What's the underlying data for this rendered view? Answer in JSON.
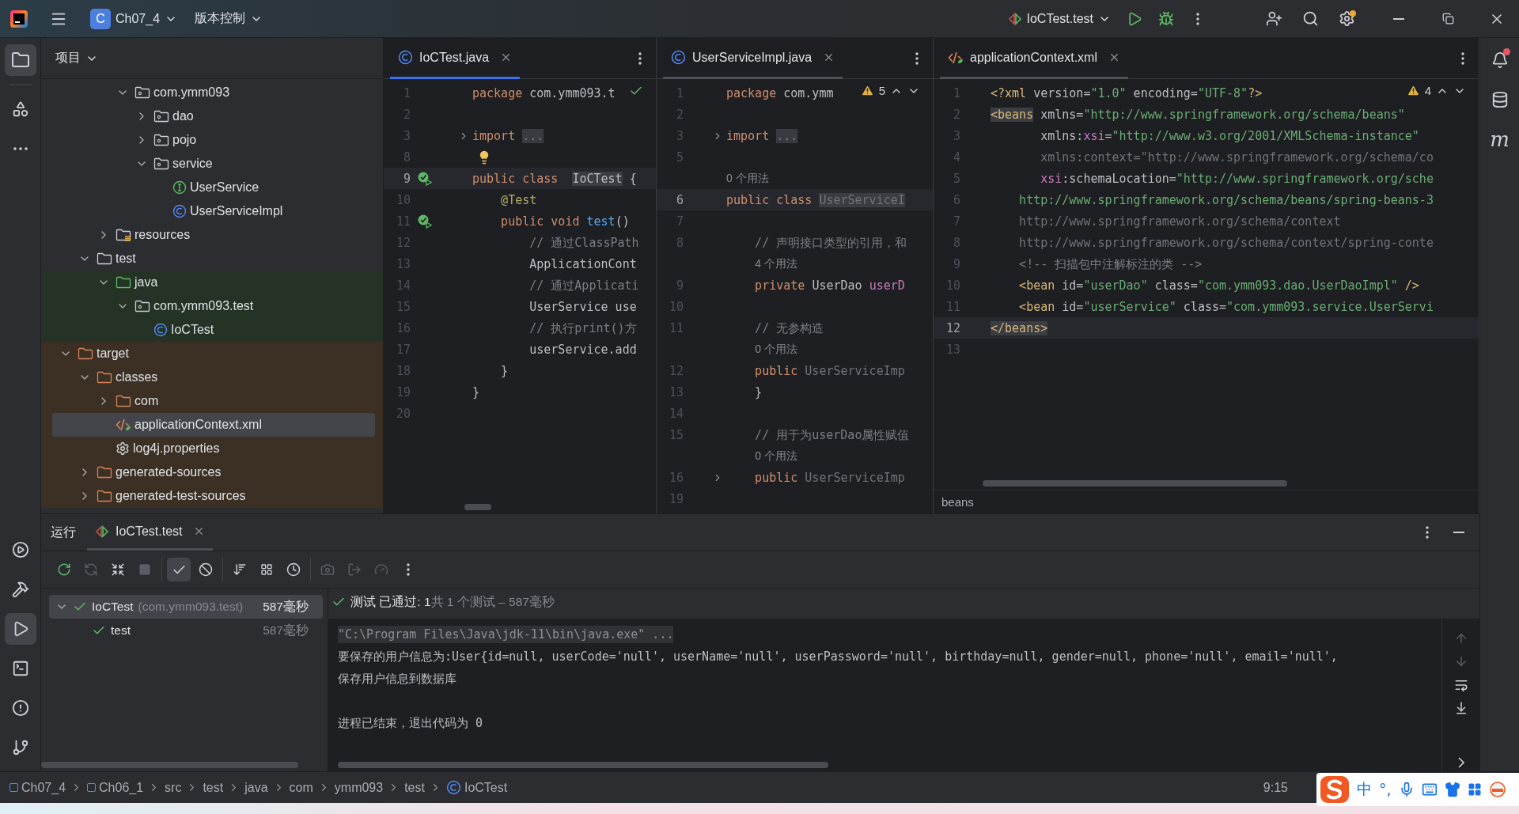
{
  "title_bar": {
    "project_badge": "C",
    "project": "Ch07_4",
    "vcs": "版本控制",
    "run_config": "IoCTest.test",
    "settings_badge": true
  },
  "left_toolbar": {
    "top": [
      {
        "kind": "project",
        "selected": true
      },
      {
        "kind": "structure",
        "selected": false
      },
      {
        "kind": "more",
        "selected": false
      }
    ],
    "bottom": [
      {
        "kind": "services",
        "selected": false
      },
      {
        "kind": "build",
        "selected": false
      },
      {
        "kind": "run",
        "selected": true
      },
      {
        "kind": "terminal",
        "selected": false
      },
      {
        "kind": "problems",
        "selected": false
      },
      {
        "kind": "git",
        "selected": false
      }
    ]
  },
  "right_toolbar": {
    "notifications_unread": true,
    "maven_label": "m"
  },
  "project": {
    "title": "项目",
    "tree": [
      {
        "children": [
          {
            "children": [
              {
                "children": [
                  {
                    "label": "com.ymm093",
                    "kind": "package",
                    "expanded": true,
                    "selected": false,
                    "children": [
                      {
                        "label": "dao",
                        "kind": "package",
                        "expanded": false,
                        "selected": false
                      },
                      {
                        "label": "pojo",
                        "kind": "package",
                        "expanded": false,
                        "selected": false
                      },
                      {
                        "label": "service",
                        "kind": "package",
                        "expanded": true,
                        "selected": false,
                        "children": [
                          {
                            "label": "UserService",
                            "kind": "interface",
                            "selected": false
                          },
                          {
                            "label": "UserServiceImpl",
                            "kind": "class",
                            "selected": false
                          }
                        ]
                      }
                    ]
                  }
                ]
              },
              {
                "label": "resources",
                "kind": "resources",
                "expanded": false,
                "selected": false
              }
            ]
          },
          {
            "label": "test",
            "kind": "folder",
            "expanded": true,
            "selected": false,
            "children": [
              {
                "label": "java",
                "kind": "folder",
                "test_sources": true,
                "expanded": true,
                "selected": false,
                "children": [
                  {
                    "label": "com.ymm093.test",
                    "kind": "package",
                    "expanded": true,
                    "selected": false,
                    "children": [
                      {
                        "label": "IoCTest",
                        "kind": "class",
                        "selected": false
                      }
                    ]
                  }
                ]
              }
            ]
          }
        ]
      },
      {
        "label": "target",
        "kind": "folder",
        "excluded": true,
        "expanded": true,
        "selected": false,
        "children": [
          {
            "label": "classes",
            "kind": "folder",
            "expanded": true,
            "selected": false,
            "children": [
              {
                "label": "com",
                "kind": "folder",
                "expanded": false,
                "selected": false
              },
              {
                "label": "applicationContext.xml",
                "kind": "xml",
                "selected": true
              },
              {
                "label": "log4j.properties",
                "kind": "properties",
                "selected": false
              }
            ]
          },
          {
            "label": "generated-sources",
            "kind": "folder",
            "expanded": false,
            "selected": false
          },
          {
            "label": "generated-test-sources",
            "kind": "folder",
            "expanded": false,
            "selected": false
          }
        ]
      }
    ]
  },
  "editors": [
    {
      "tab": {
        "label": "IoCTest.java",
        "kind": "class",
        "selected": true
      },
      "inspection": {
        "kind": "ok"
      },
      "lines": [
        {
          "kind": "code",
          "n": "1",
          "tokens": [
            {
              "t": "package ",
              "kind": "kw"
            },
            {
              "t": "com.ymm093.t",
              "kind": "plain"
            }
          ]
        },
        {
          "kind": "code",
          "n": "2"
        },
        {
          "kind": "code",
          "n": "3",
          "fold": true,
          "tokens": [
            {
              "t": "import ",
              "kind": "kw"
            },
            {
              "t": "...",
              "kind": "fold"
            }
          ]
        },
        {
          "kind": "code",
          "n": "8",
          "bulb": true
        },
        {
          "kind": "code",
          "n": "9",
          "current": true,
          "run_gutter": true,
          "tokens": [
            {
              "t": "public class  ",
              "kind": "kw"
            },
            {
              "t": "IoCTest",
              "kind": "plain",
              "hl": true
            },
            {
              "t": " {",
              "kind": "plain"
            }
          ]
        },
        {
          "kind": "code",
          "n": "10",
          "tokens": [
            {
              "t": "    @Test",
              "kind": "annot"
            }
          ]
        },
        {
          "kind": "code",
          "n": "11",
          "run_gutter": true,
          "tokens": [
            {
              "t": "    public void ",
              "kind": "kw"
            },
            {
              "t": "test",
              "kind": "fn"
            },
            {
              "t": "()",
              "kind": "plain"
            }
          ]
        },
        {
          "kind": "code",
          "n": "12",
          "tokens": [
            {
              "t": "        // 通过ClassPath",
              "kind": "comment"
            }
          ]
        },
        {
          "kind": "code",
          "n": "13",
          "tokens": [
            {
              "t": "        ApplicationCont",
              "kind": "plain"
            }
          ]
        },
        {
          "kind": "code",
          "n": "14",
          "tokens": [
            {
              "t": "        // 通过Applicati",
              "kind": "comment"
            }
          ]
        },
        {
          "kind": "code",
          "n": "15",
          "tokens": [
            {
              "t": "        UserService use",
              "kind": "plain"
            }
          ]
        },
        {
          "kind": "code",
          "n": "16",
          "tokens": [
            {
              "t": "        // 执行print()方",
              "kind": "comment"
            }
          ]
        },
        {
          "kind": "code",
          "n": "17",
          "tokens": [
            {
              "t": "        userService.add",
              "kind": "plain"
            }
          ]
        },
        {
          "kind": "code",
          "n": "18",
          "tokens": [
            {
              "t": "    }",
              "kind": "plain"
            }
          ]
        },
        {
          "kind": "code",
          "n": "19",
          "tokens": [
            {
              "t": "}",
              "kind": "plain"
            }
          ]
        },
        {
          "kind": "code",
          "n": "20"
        }
      ]
    },
    {
      "tab": {
        "label": "UserServiceImpl.java",
        "kind": "class",
        "selected": false
      },
      "inspection": {
        "kind": "warning",
        "count": "5"
      },
      "lines": [
        {
          "kind": "code",
          "n": "1",
          "tokens": [
            {
              "t": "package ",
              "kind": "kw"
            },
            {
              "t": "com.ymm",
              "kind": "plain"
            }
          ]
        },
        {
          "kind": "code",
          "n": "2"
        },
        {
          "kind": "code",
          "n": "3",
          "fold": true,
          "tokens": [
            {
              "t": "import ",
              "kind": "kw"
            },
            {
              "t": "...",
              "kind": "fold"
            }
          ]
        },
        {
          "kind": "code",
          "n": "5"
        },
        {
          "kind": "inlay",
          "text": "0 个用法"
        },
        {
          "kind": "code",
          "n": "6",
          "current": true,
          "tokens": [
            {
              "t": "public class ",
              "kind": "kw"
            },
            {
              "t": "UserServiceI",
              "kind": "dim",
              "hl": true
            }
          ]
        },
        {
          "kind": "code",
          "n": "7"
        },
        {
          "kind": "code",
          "n": "8",
          "tokens": [
            {
              "t": "    // 声明接口类型的引用，和",
              "kind": "comment"
            }
          ]
        },
        {
          "kind": "inlay",
          "text": "    4 个用法"
        },
        {
          "kind": "code",
          "n": "9",
          "tokens": [
            {
              "t": "    private ",
              "kind": "kw"
            },
            {
              "t": "UserDao ",
              "kind": "plain"
            },
            {
              "t": "userD",
              "kind": "field"
            }
          ]
        },
        {
          "kind": "code",
          "n": "10"
        },
        {
          "kind": "code",
          "n": "11",
          "tokens": [
            {
              "t": "    // 无参构造",
              "kind": "comment"
            }
          ]
        },
        {
          "kind": "inlay",
          "text": "    0 个用法"
        },
        {
          "kind": "code",
          "n": "12",
          "tokens": [
            {
              "t": "    public ",
              "kind": "kw"
            },
            {
              "t": "UserServiceImp",
              "kind": "dim"
            }
          ]
        },
        {
          "kind": "code",
          "n": "13",
          "tokens": [
            {
              "t": "    }",
              "kind": "plain"
            }
          ]
        },
        {
          "kind": "code",
          "n": "14"
        },
        {
          "kind": "code",
          "n": "15",
          "tokens": [
            {
              "t": "    // 用于为userDao属性赋值",
              "kind": "comment"
            }
          ]
        },
        {
          "kind": "inlay",
          "text": "    0 个用法"
        },
        {
          "kind": "code",
          "n": "16",
          "fold": true,
          "tokens": [
            {
              "t": "    public ",
              "kind": "kw"
            },
            {
              "t": "UserServiceImp",
              "kind": "dim"
            }
          ]
        },
        {
          "kind": "code",
          "n": "19"
        }
      ]
    },
    {
      "tab": {
        "label": "applicationContext.xml",
        "kind": "xml",
        "selected": false
      },
      "inspection": {
        "kind": "warning",
        "count": "4"
      },
      "breadcrumb": "beans",
      "lines": [
        {
          "kind": "code",
          "n": "1",
          "tokens": [
            {
              "t": "<?xml",
              "kind": "tag"
            },
            {
              "t": " version=",
              "kind": "plain"
            },
            {
              "t": "\"1.0\"",
              "kind": "str"
            },
            {
              "t": " encoding=",
              "kind": "plain"
            },
            {
              "t": "\"UTF-8\"",
              "kind": "str"
            },
            {
              "t": "?>",
              "kind": "tag"
            }
          ]
        },
        {
          "kind": "code",
          "n": "2",
          "tokens": [
            {
              "t": "<beans",
              "kind": "tag",
              "hl": true
            },
            {
              "t": " xmlns=",
              "kind": "plain"
            },
            {
              "t": "\"http://www.springframework.org/schema/beans\"",
              "kind": "str"
            }
          ]
        },
        {
          "kind": "code",
          "n": "3",
          "tokens": [
            {
              "t": "       xmlns:",
              "kind": "plain"
            },
            {
              "t": "xsi",
              "kind": "ns"
            },
            {
              "t": "=",
              "kind": "plain"
            },
            {
              "t": "\"http://www.w3.org/2001/XMLSchema-instance\"",
              "kind": "str"
            }
          ]
        },
        {
          "kind": "code",
          "n": "4",
          "tokens": [
            {
              "t": "       xmlns:context=\"http://www.springframework.org/schema/co",
              "kind": "dim"
            }
          ]
        },
        {
          "kind": "code",
          "n": "5",
          "tokens": [
            {
              "t": "       xsi",
              "kind": "ns"
            },
            {
              "t": ":schemaLocation=",
              "kind": "plain"
            },
            {
              "t": "\"http://www.springframework.org/sche",
              "kind": "str"
            }
          ]
        },
        {
          "kind": "code",
          "n": "6",
          "tokens": [
            {
              "t": "    http://www.springframework.org/schema/beans/spring-beans-3",
              "kind": "str"
            }
          ]
        },
        {
          "kind": "code",
          "n": "7",
          "tokens": [
            {
              "t": "    http://www.springframework.org/schema/context",
              "kind": "dim"
            }
          ]
        },
        {
          "kind": "code",
          "n": "8",
          "tokens": [
            {
              "t": "    http://www.springframework.org/schema/context/spring-conte",
              "kind": "dim"
            }
          ]
        },
        {
          "kind": "code",
          "n": "9",
          "tokens": [
            {
              "t": "    <!-- 扫描包中注解标注的类 -->",
              "kind": "comment"
            }
          ]
        },
        {
          "kind": "code",
          "n": "10",
          "tokens": [
            {
              "t": "    <bean ",
              "kind": "tag"
            },
            {
              "t": "id=",
              "kind": "plain"
            },
            {
              "t": "\"userDao\"",
              "kind": "str"
            },
            {
              "t": " class=",
              "kind": "plain"
            },
            {
              "t": "\"com.ymm093.dao.UserDaoImpl\"",
              "kind": "str"
            },
            {
              "t": " />",
              "kind": "tag"
            }
          ]
        },
        {
          "kind": "code",
          "n": "11",
          "tokens": [
            {
              "t": "    <bean ",
              "kind": "tag"
            },
            {
              "t": "id=",
              "kind": "plain"
            },
            {
              "t": "\"userService\"",
              "kind": "str"
            },
            {
              "t": " class=",
              "kind": "plain"
            },
            {
              "t": "\"com.ymm093.service.UserServi",
              "kind": "str"
            }
          ]
        },
        {
          "kind": "code",
          "n": "12",
          "current": true,
          "tokens": [
            {
              "t": "</beans>",
              "kind": "tag",
              "hl": true
            }
          ]
        },
        {
          "kind": "code",
          "n": "13"
        }
      ]
    }
  ],
  "run": {
    "title": "运行",
    "tab": {
      "label": "IoCTest.test",
      "selected": true
    },
    "toolbar": [
      [
        {
          "kind": "rerun",
          "disabled": false,
          "selected": false
        },
        {
          "kind": "rerun-failed",
          "disabled": true,
          "selected": false
        },
        {
          "kind": "toggle-auto-test",
          "disabled": false,
          "selected": false
        },
        {
          "kind": "stop",
          "disabled": true,
          "selected": false
        }
      ],
      [
        {
          "kind": "show-passed",
          "disabled": false,
          "selected": true
        },
        {
          "kind": "show-ignored",
          "disabled": false,
          "selected": false
        }
      ],
      [
        {
          "kind": "sort",
          "disabled": false,
          "selected": false
        },
        {
          "kind": "collapse",
          "disabled": false,
          "selected": false
        },
        {
          "kind": "history",
          "disabled": false,
          "selected": false
        }
      ],
      [
        {
          "kind": "screenshot",
          "disabled": true,
          "selected": false
        },
        {
          "kind": "export",
          "disabled": true,
          "selected": false
        },
        {
          "kind": "coverage",
          "disabled": true,
          "selected": false
        },
        {
          "kind": "more",
          "disabled": false,
          "selected": false
        }
      ]
    ],
    "tree": [
      {
        "label": "IoCTest",
        "detail": "(com.ymm093.test)",
        "time": "587毫秒",
        "passed": true,
        "selected": true,
        "expanded": true,
        "children": [
          {
            "label": "test",
            "time": "587毫秒",
            "passed": true,
            "selected": false
          }
        ]
      }
    ],
    "summary": {
      "passed": true,
      "status": "测试 已通过: 1",
      "detail": "共 1 个测试 – 587毫秒"
    },
    "console": [
      {
        "kind": "command",
        "text": "\"C:\\Program Files\\Java\\jdk-11\\bin\\java.exe\" ..."
      },
      {
        "kind": "output",
        "text": "要保存的用户信息为:User{id=null, userCode='null', userName='null', userPassword='null', birthday=null, gender=null, phone='null', email='null',"
      },
      {
        "kind": "output",
        "text": "保存用户信息到数据库"
      },
      {
        "kind": "blank"
      },
      {
        "kind": "output",
        "text": "进程已结束，退出代码为 0"
      }
    ]
  },
  "status_bar": {
    "path": [
      {
        "label": "Ch07_4",
        "kind": "module"
      },
      {
        "label": "Ch06_1",
        "kind": "module"
      },
      {
        "label": "src",
        "kind": "plain"
      },
      {
        "label": "test",
        "kind": "plain"
      },
      {
        "label": "java",
        "kind": "plain"
      },
      {
        "label": "com",
        "kind": "plain"
      },
      {
        "label": "ymm093",
        "kind": "plain"
      },
      {
        "label": "test",
        "kind": "plain"
      },
      {
        "label": "IoCTest",
        "kind": "class"
      }
    ],
    "position": "9:15"
  },
  "ime_toolbar": {
    "mode": "中",
    "punctuation": "°,"
  }
}
